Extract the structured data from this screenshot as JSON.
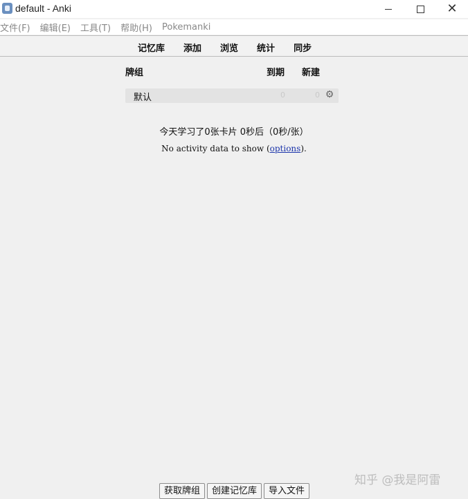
{
  "window": {
    "title": "default - Anki",
    "minimize_icon": "minimize-icon",
    "maximize_icon": "maximize-icon",
    "close_icon": "close-icon",
    "close_glyph": "✕"
  },
  "menubar": {
    "items": [
      "文件(F)",
      "编辑(E)",
      "工具(T)",
      "帮助(H)",
      "Pokemanki"
    ]
  },
  "toolbar": {
    "links": [
      "记忆库",
      "添加",
      "浏览",
      "统计",
      "同步"
    ]
  },
  "decks": {
    "headers": {
      "deck": "牌组",
      "due": "到期",
      "new": "新建"
    },
    "rows": [
      {
        "name": "默认",
        "due": "0",
        "new": "0",
        "options_icon": "gear-icon"
      }
    ]
  },
  "stats": {
    "studied_today": "今天学习了0张卡片 0秒后（0秒/张）",
    "no_activity_prefix": "No activity data to show (",
    "no_activity_link": "options",
    "no_activity_suffix": ")."
  },
  "bottom": {
    "buttons": [
      "获取牌组",
      "创建记忆库",
      "导入文件"
    ]
  },
  "watermark": "知乎 @我是阿雷",
  "colors": {
    "background": "#f0f0f0",
    "link": "#1a33aa"
  }
}
